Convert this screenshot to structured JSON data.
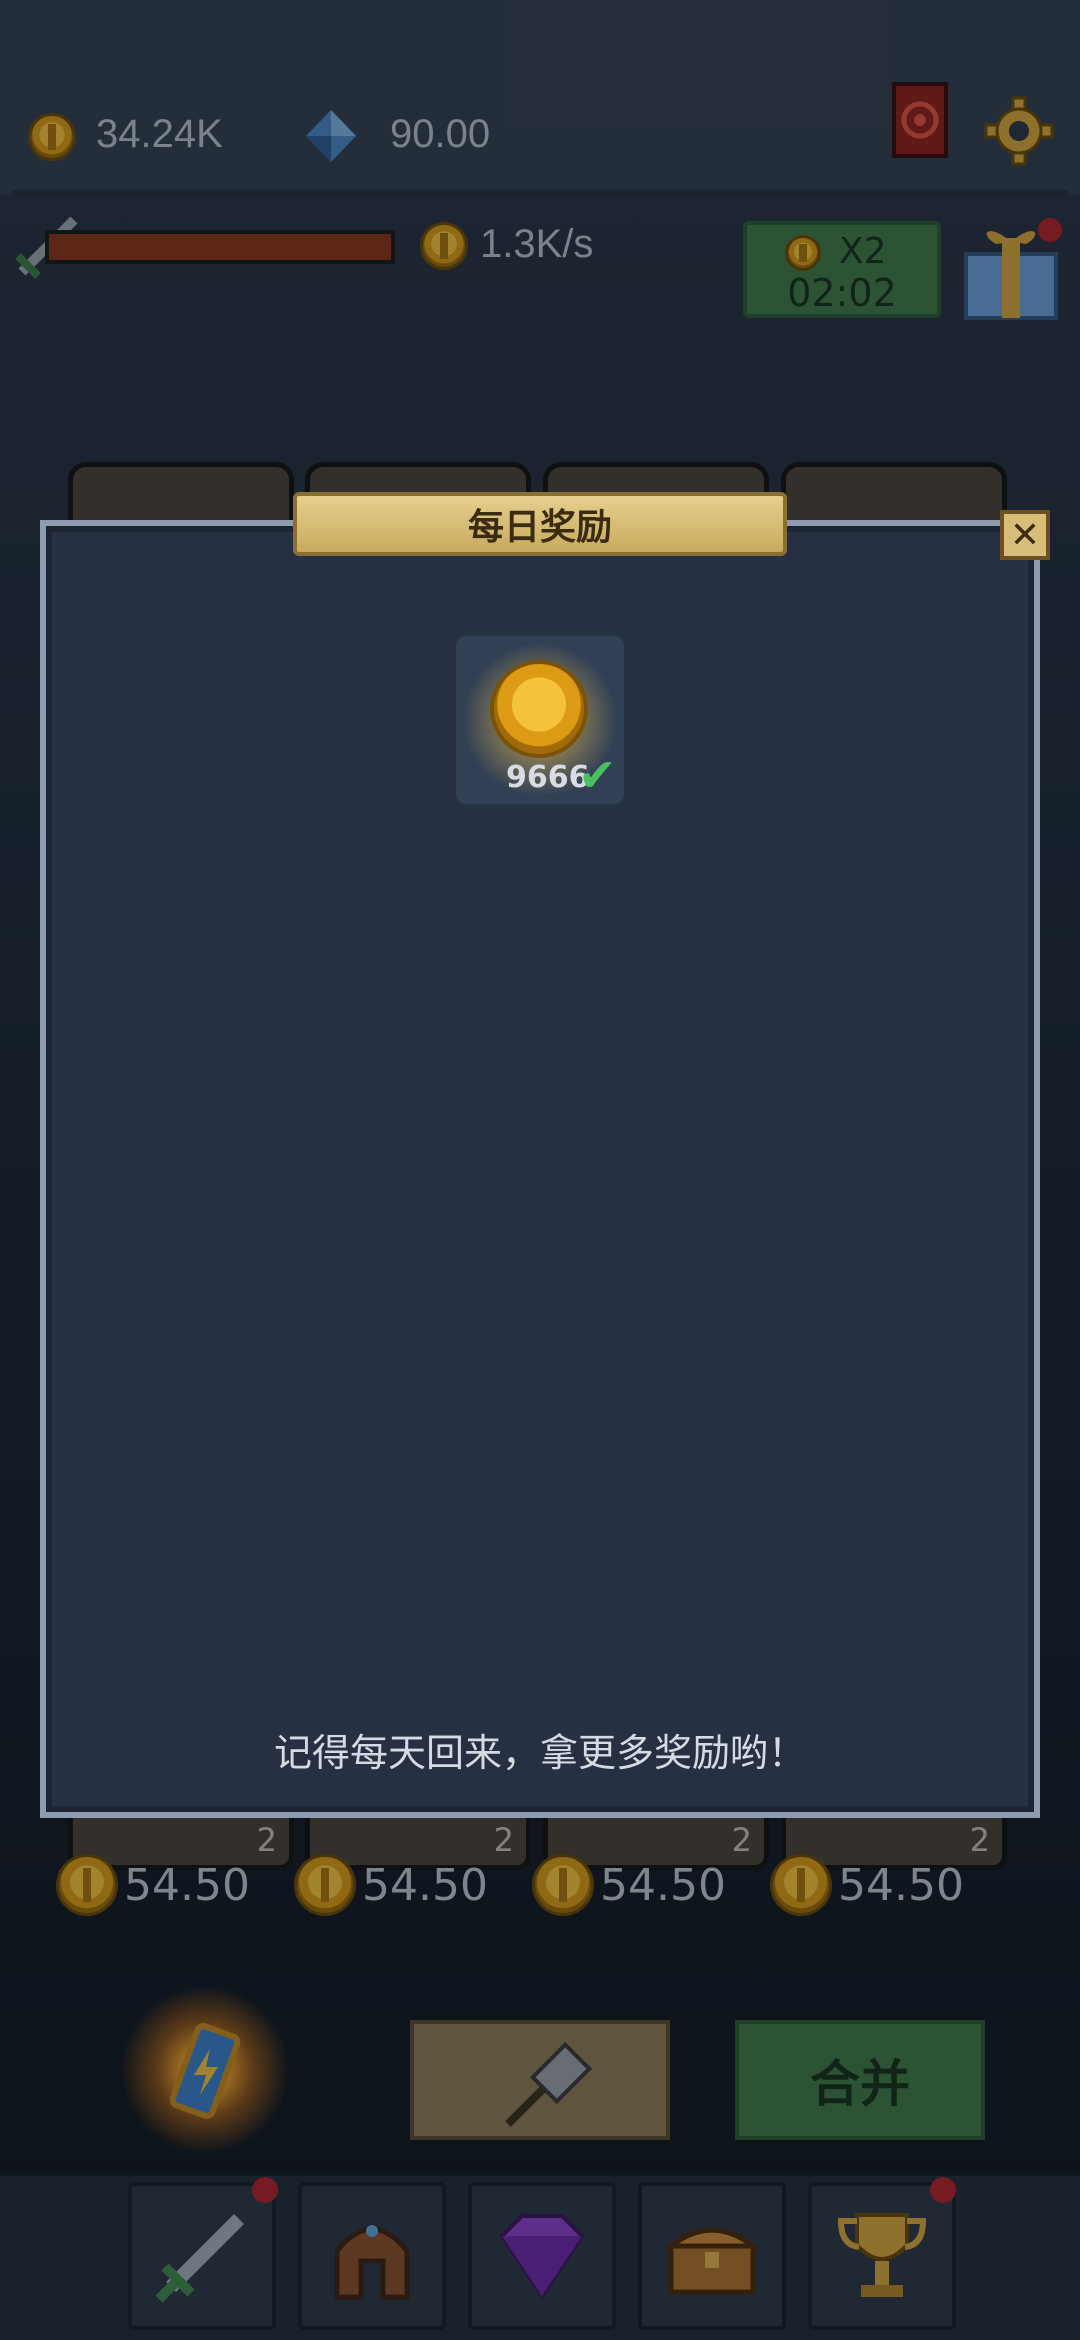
{
  "top_bar": {
    "coins": "34.24K",
    "gems": "90.00"
  },
  "status": {
    "income_rate": "1.3K/s",
    "boost_multiplier": "X2",
    "boost_timer": "02:02"
  },
  "slots": [
    {
      "level": "2",
      "price": "54.50"
    },
    {
      "level": "2",
      "price": "54.50"
    },
    {
      "level": "2",
      "price": "54.50"
    },
    {
      "level": "2",
      "price": "54.50"
    }
  ],
  "modal": {
    "title": "每日奖励",
    "reward_amount": "9666",
    "footer": "记得每天回来，拿更多奖励哟！"
  },
  "actions": {
    "merge_label": "合并"
  },
  "nav": {
    "items": [
      "sword-icon",
      "helmet-icon",
      "gem-icon",
      "chest-icon",
      "trophy-icon"
    ]
  },
  "colors": {
    "accent_green": "#3f7a46",
    "gold": "#d99a14",
    "notification_red": "#b3232a"
  }
}
